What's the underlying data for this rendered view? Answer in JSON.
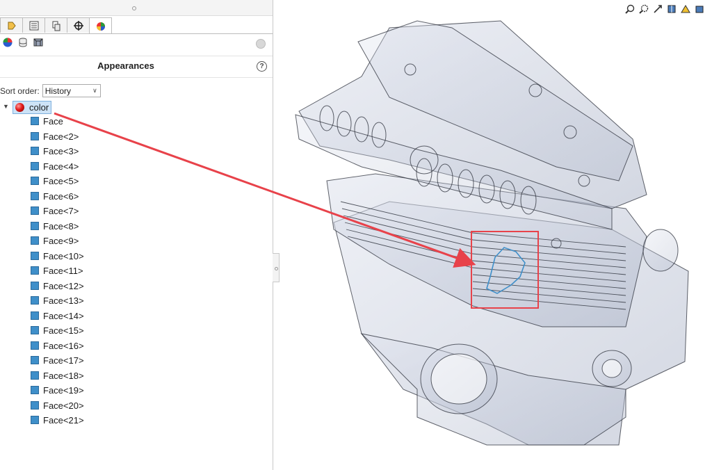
{
  "panel": {
    "title": "Appearances",
    "help": "?",
    "sort": {
      "label": "Sort order:",
      "value": "History"
    },
    "tabs": [
      "feature-manager-icon",
      "property-manager-icon",
      "configuration-manager-icon",
      "dimxpert-icon",
      "display-manager-icon"
    ],
    "active_tab": 4
  },
  "tree": {
    "root": {
      "label": "color",
      "icon": "red-sphere-icon"
    },
    "items": [
      "Face",
      "Face<2>",
      "Face<3>",
      "Face<4>",
      "Face<5>",
      "Face<6>",
      "Face<7>",
      "Face<8>",
      "Face<9>",
      "Face<10>",
      "Face<11>",
      "Face<12>",
      "Face<13>",
      "Face<14>",
      "Face<15>",
      "Face<16>",
      "Face<17>",
      "Face<18>",
      "Face<19>",
      "Face<20>",
      "Face<21>"
    ]
  },
  "view_toolbar": [
    "zoom-to-fit-icon",
    "zoom-to-area-icon",
    "previous-view-icon",
    "section-view-icon",
    "view-orientation-icon",
    "display-style-icon"
  ],
  "colors": {
    "annotation": "#e8424a",
    "selection": "#3f8fc9",
    "highlight": "#cde3f7"
  }
}
